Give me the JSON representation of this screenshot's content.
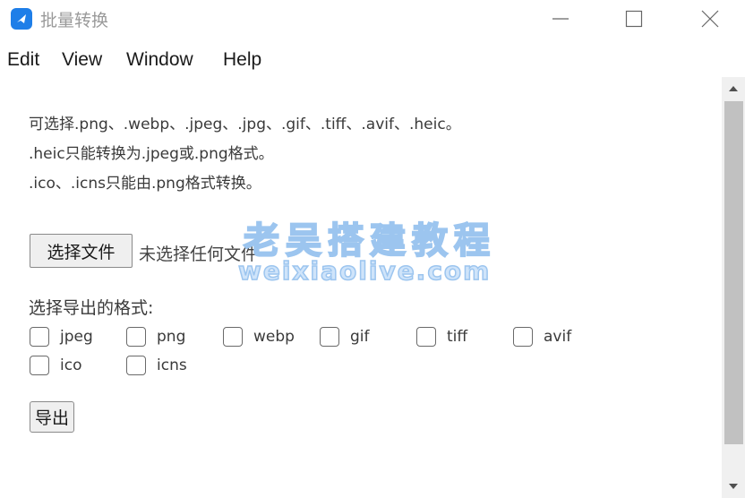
{
  "window": {
    "title": "批量转换",
    "accent": "#1e7ee8"
  },
  "menu": {
    "items": [
      "Edit",
      "View",
      "Window",
      "Help"
    ]
  },
  "info": {
    "lines": [
      "可选择.png、.webp、.jpeg、.jpg、.gif、.tiff、.avif、.heic。",
      ".heic只能转换为.jpeg或.png格式。",
      ".ico、.icns只能由.png格式转换。"
    ]
  },
  "file": {
    "button_label": "选择文件",
    "status": "未选择任何文件"
  },
  "formats": {
    "label": "选择导出的格式:",
    "options": [
      {
        "label": "jpeg",
        "checked": false
      },
      {
        "label": "png",
        "checked": false
      },
      {
        "label": "webp",
        "checked": false
      },
      {
        "label": "gif",
        "checked": false
      },
      {
        "label": "tiff",
        "checked": false
      },
      {
        "label": "avif",
        "checked": false
      },
      {
        "label": "ico",
        "checked": false
      },
      {
        "label": "icns",
        "checked": false
      }
    ]
  },
  "export": {
    "button_label": "导出"
  },
  "watermark": {
    "cn": "老吴搭建教程",
    "en": "weixiaolive.com"
  }
}
